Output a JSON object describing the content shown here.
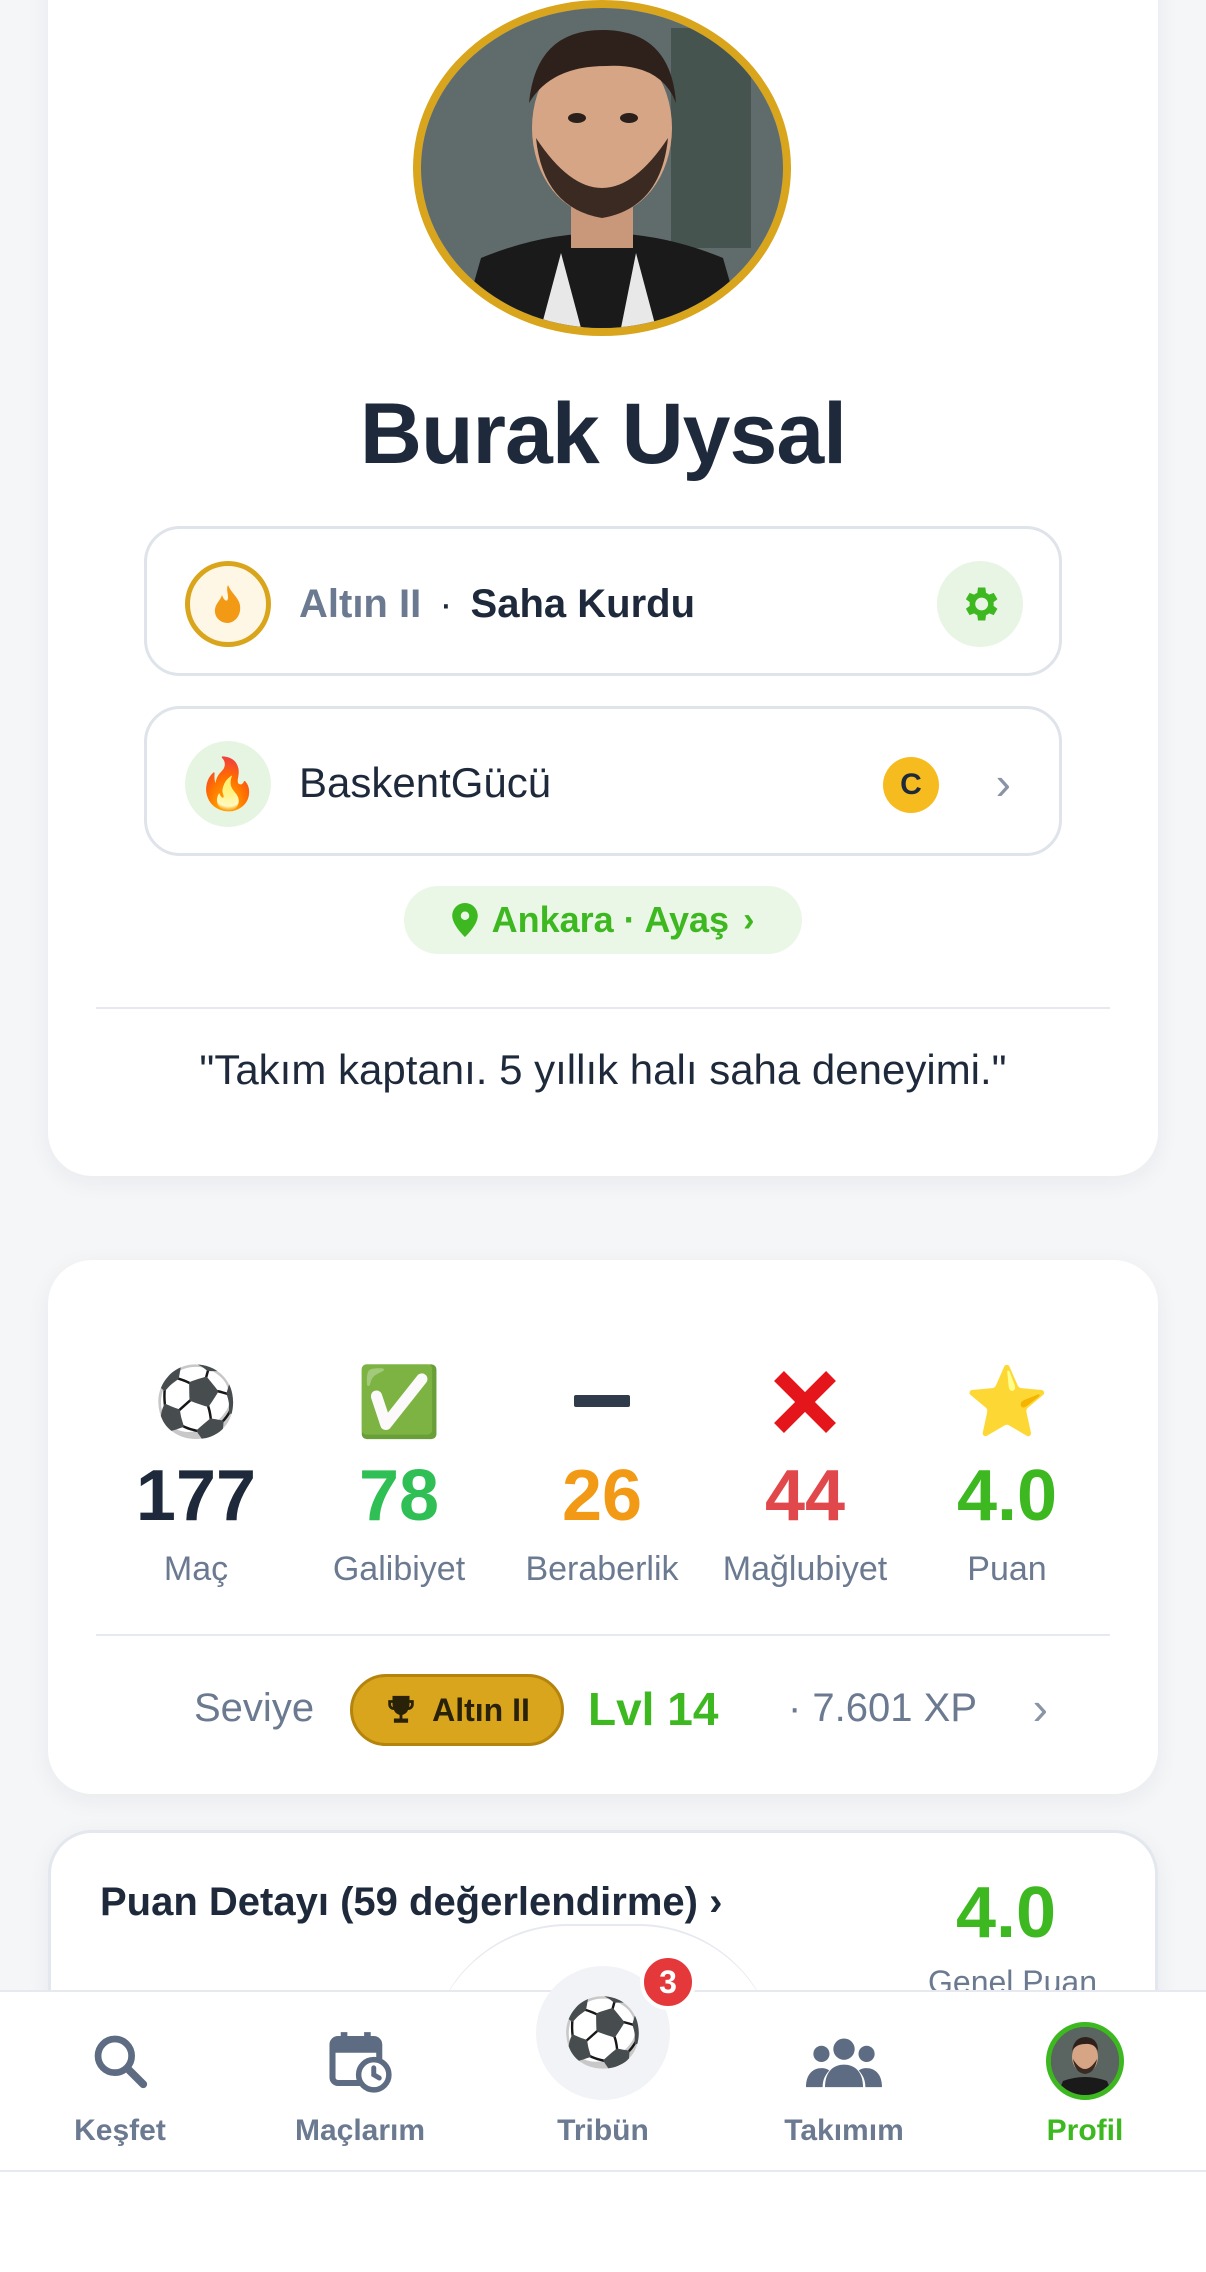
{
  "profile": {
    "name": "Burak Uysal",
    "rank_tier": "Altın II",
    "rank_separator": "·",
    "rank_title": "Saha Kurdu",
    "team_name": "BaskentGücü",
    "team_emblem": "🔥",
    "captain_badge": "C",
    "location": "Ankara · Ayaş",
    "bio": "\"Takım kaptanı. 5 yıllık halı saha deneyimi.\""
  },
  "stats": [
    {
      "icon": "⚽",
      "value": "177",
      "label": "Maç",
      "color": "#1e2a3b"
    },
    {
      "icon": "✅",
      "value": "78",
      "label": "Galibiyet",
      "color": "#2fbf55"
    },
    {
      "icon": "—",
      "value": "26",
      "label": "Beraberlik",
      "color": "#f29a16"
    },
    {
      "icon": "✖",
      "value": "44",
      "label": "Mağlubiyet",
      "color": "#e0484b"
    },
    {
      "icon": "⭐",
      "value": "4.0",
      "label": "Puan",
      "color": "#3db820"
    }
  ],
  "level": {
    "label": "Seviye",
    "badge": "Altın II",
    "lvl": "Lvl 14",
    "xp": "· 7.601 XP"
  },
  "rating": {
    "title": "Puan Detayı (59 değerlendirme)  ›",
    "value": "4.0",
    "caption": "Genel Puan"
  },
  "nav": {
    "explore": "Keşfet",
    "matches": "Maçlarım",
    "tribune": "Tribün",
    "tribune_badge": "3",
    "team": "Takımım",
    "profile": "Profil"
  },
  "colors": {
    "accent_green": "#3db820",
    "gold": "#d8a51c",
    "text_dark": "#1e2a3b",
    "text_muted": "#6b7a90"
  }
}
